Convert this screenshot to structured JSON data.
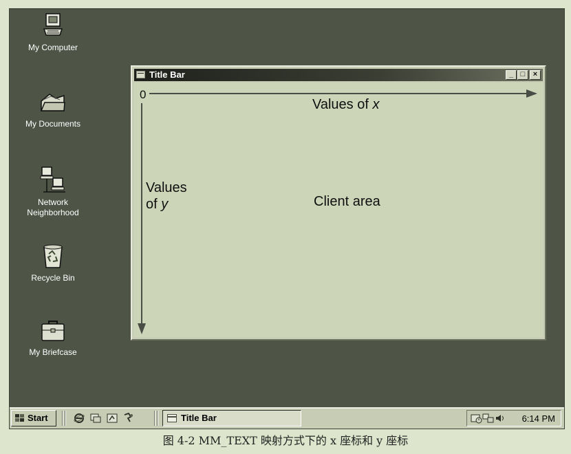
{
  "desktop": {
    "icons": [
      {
        "label": "My Computer",
        "icon": "computer-icon"
      },
      {
        "label": "My Documents",
        "icon": "folder-icon"
      },
      {
        "label": "Network\nNeighborhood",
        "icon": "network-icon"
      },
      {
        "label": "Recycle Bin",
        "icon": "recycle-bin-icon"
      },
      {
        "label": "My Briefcase",
        "icon": "briefcase-icon"
      }
    ]
  },
  "window": {
    "title": "Title Bar",
    "buttons": {
      "minimize": "_",
      "maximize": "□",
      "close": "×"
    },
    "client": {
      "origin": "0",
      "x_label_prefix": "Values of ",
      "x_label_var": "x",
      "y_label_line1": "Values",
      "y_label_prefix": "of ",
      "y_label_var": "y",
      "center_label": "Client area"
    }
  },
  "taskbar": {
    "start_label": "Start",
    "quick_launch": [
      "internet-explorer-icon",
      "desktop-icon",
      "channels-icon",
      "outlook-express-icon"
    ],
    "task_button_label": "Title Bar",
    "tray_icons": [
      "scheduler-icon",
      "network-tray-icon",
      "volume-icon"
    ],
    "clock": "6:14 PM"
  },
  "caption": "图 4-2 MM_TEXT 映射方式下的 x 座标和 y 座标",
  "colors": {
    "desktop": "#4e5547",
    "window_face": "#c9ceb6",
    "client": "#cdd5b9",
    "taskbar": "#c7ccb4",
    "axis": "#4a4d45",
    "page": "#dde6cc"
  }
}
